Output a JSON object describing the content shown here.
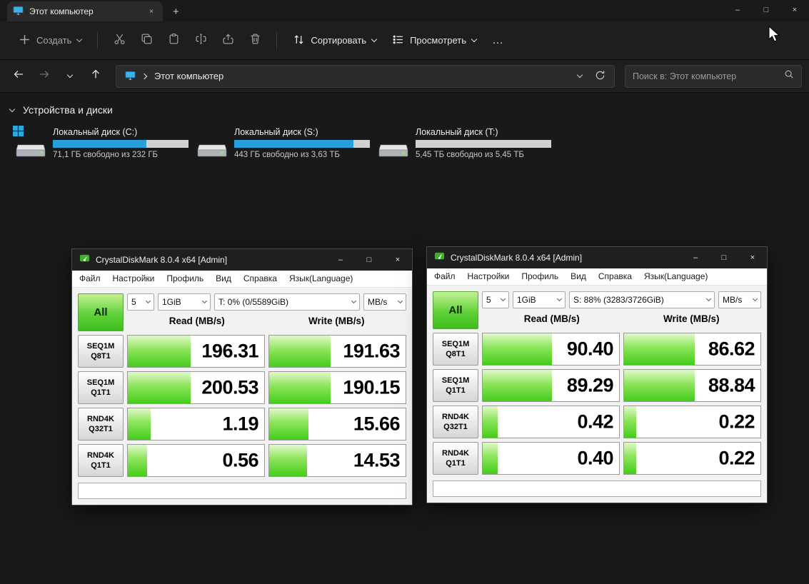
{
  "glyphs": {
    "minimize": "–",
    "maximize": "□",
    "close": "×",
    "new_tab": "+",
    "more": "…"
  },
  "explorer": {
    "tab_title": "Этот компьютер",
    "toolbar": {
      "new_label": "Создать",
      "sort_label": "Сортировать",
      "view_label": "Просмотреть"
    },
    "breadcrumb_root": "Этот компьютер",
    "search_placeholder": "Поиск в: Этот компьютер",
    "section_title": "Устройства и диски",
    "drives": [
      {
        "name": "Локальный диск (C:)",
        "free": "71,1 ГБ свободно из 232 ГБ",
        "used_percent": 69,
        "has_windows_logo": true
      },
      {
        "name": "Локальный диск (S:)",
        "free": "443 ГБ свободно из 3,63 ТБ",
        "used_percent": 88,
        "has_windows_logo": false
      },
      {
        "name": "Локальный диск (T:)",
        "free": "5,45 ТБ свободно из 5,45 ТБ",
        "used_percent": 0,
        "has_windows_logo": false
      }
    ]
  },
  "cdm_windows": [
    {
      "title": "CrystalDiskMark 8.0.4 x64 [Admin]",
      "menu": [
        "Файл",
        "Настройки",
        "Профиль",
        "Вид",
        "Справка",
        "Язык(Language)"
      ],
      "all_label": "All",
      "runs": "5",
      "size": "1GiB",
      "target": "T: 0% (0/5589GiB)",
      "unit": "MB/s",
      "read_header": "Read (MB/s)",
      "write_header": "Write (MB/s)",
      "status_text": "",
      "rows": [
        {
          "test": "SEQ1M",
          "queue": "Q8T1",
          "read": "196.31",
          "write": "191.63",
          "read_bar": 46,
          "write_bar": 45
        },
        {
          "test": "SEQ1M",
          "queue": "Q1T1",
          "read": "200.53",
          "write": "190.15",
          "read_bar": 46,
          "write_bar": 45
        },
        {
          "test": "RND4K",
          "queue": "Q32T1",
          "read": "1.19",
          "write": "15.66",
          "read_bar": 17,
          "write_bar": 29
        },
        {
          "test": "RND4K",
          "queue": "Q1T1",
          "read": "0.56",
          "write": "14.53",
          "read_bar": 14,
          "write_bar": 28
        }
      ]
    },
    {
      "title": "CrystalDiskMark 8.0.4 x64 [Admin]",
      "menu": [
        "Файл",
        "Настройки",
        "Профиль",
        "Вид",
        "Справка",
        "Язык(Language)"
      ],
      "all_label": "All",
      "runs": "5",
      "size": "1GiB",
      "target": "S: 88% (3283/3726GiB)",
      "unit": "MB/s",
      "read_header": "Read (MB/s)",
      "write_header": "Write (MB/s)",
      "status_text": "",
      "rows": [
        {
          "test": "SEQ1M",
          "queue": "Q8T1",
          "read": "90.40",
          "write": "86.62",
          "read_bar": 51,
          "write_bar": 52
        },
        {
          "test": "SEQ1M",
          "queue": "Q1T1",
          "read": "89.29",
          "write": "88.84",
          "read_bar": 51,
          "write_bar": 52
        },
        {
          "test": "RND4K",
          "queue": "Q32T1",
          "read": "0.42",
          "write": "0.22",
          "read_bar": 11,
          "write_bar": 9
        },
        {
          "test": "RND4K",
          "queue": "Q1T1",
          "read": "0.40",
          "write": "0.22",
          "read_bar": 11,
          "write_bar": 9
        }
      ]
    }
  ]
}
